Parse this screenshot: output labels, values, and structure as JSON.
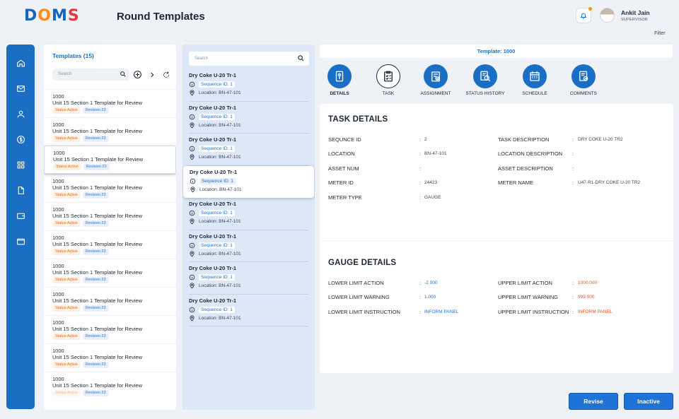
{
  "app": {
    "logo": [
      "D",
      "O",
      "M",
      "S"
    ],
    "page_title": "Round Templates",
    "user": {
      "name": "Ankit Jain",
      "role": "SUPERVISOR"
    },
    "filter_label": "Filter"
  },
  "templates": {
    "title": "Templates (15)",
    "search_placeholder": "Search",
    "items": [
      {
        "code": "1000",
        "name": "Unit 15 Section 1 Template for Review",
        "status": "Status Active",
        "revision": "Revision 23"
      },
      {
        "code": "1000",
        "name": "Unit 15 Section 1 Template for Review",
        "status": "Status Active",
        "revision": "Revision 23"
      },
      {
        "code": "1000",
        "name": "Unit 15 Section 1 Template for Review",
        "status": "Status Active",
        "revision": "Revision 23"
      },
      {
        "code": "1000",
        "name": "Unit 15 Section 1 Template for Review",
        "status": "Status Active",
        "revision": "Revision 23"
      },
      {
        "code": "1000",
        "name": "Unit 15 Section 1 Template for Review",
        "status": "Status Active",
        "revision": "Revision 23"
      },
      {
        "code": "1000",
        "name": "Unit 15 Section 1 Template for Review",
        "status": "Status Active",
        "revision": "Revision 23"
      },
      {
        "code": "1000",
        "name": "Unit 15 Section 1 Template for Review",
        "status": "Status Active",
        "revision": "Revision 23"
      },
      {
        "code": "1000",
        "name": "Unit 15 Section 1 Template for Review",
        "status": "Status Active",
        "revision": "Revision 23"
      },
      {
        "code": "1000",
        "name": "Unit 15 Section 1 Template for Review",
        "status": "Status Active",
        "revision": "Revision 23"
      },
      {
        "code": "1000",
        "name": "Unit 15 Section 1 Template for Review",
        "status": "Status Active",
        "revision": "Revision 23"
      },
      {
        "code": "1000",
        "name": "Unit 15 Section 1 Template for Review",
        "status": "Status Active",
        "revision": "Revision 23"
      }
    ]
  },
  "sequences": {
    "search_placeholder": "Search",
    "items": [
      {
        "name": "Dry Coke U-20 Tr-1",
        "sequence": "Sequence ID: 1",
        "location": "Location: BN-47-101"
      },
      {
        "name": "Dry Coke U-20 Tr-1",
        "sequence": "Sequence ID: 1",
        "location": "Location: BN-47-101"
      },
      {
        "name": "Dry Coke U-20 Tr-1",
        "sequence": "Sequence ID: 1",
        "location": "Location: BN-47-101"
      },
      {
        "name": "Dry Coke U-20 Tr-1",
        "sequence": "Sequence ID: 1",
        "location": "Location: BN-47-101"
      },
      {
        "name": "Dry Coke U-20 Tr-1",
        "sequence": "Sequence ID: 1",
        "location": "Location: BN-47-101"
      },
      {
        "name": "Dry Coke U-20 Tr-1",
        "sequence": "Sequence ID: 1",
        "location": "Location: BN-47-101"
      },
      {
        "name": "Dry Coke U-20 Tr-1",
        "sequence": "Sequence ID: 1",
        "location": "Location: BN-47-101"
      },
      {
        "name": "Dry Coke U-20 Tr-1",
        "sequence": "Sequence ID: 1",
        "location": "Location: BN-47-101"
      }
    ]
  },
  "detail": {
    "banner": "Template: 1000",
    "tabs": [
      {
        "label": "DETAILS",
        "icon": "details-icon"
      },
      {
        "label": "TASK",
        "icon": "task-icon"
      },
      {
        "label": "ASSIGNMENT",
        "icon": "assignment-icon"
      },
      {
        "label": "STATUS HISTORY",
        "icon": "status-history-icon"
      },
      {
        "label": "SCHEDULE",
        "icon": "schedule-icon"
      },
      {
        "label": "COMMENTS",
        "icon": "comments-icon"
      }
    ],
    "task_title": "TASK DETAILS",
    "task_fields_left": [
      {
        "label": "SEQUNCE ID",
        "value": "2"
      },
      {
        "label": "LOCATION",
        "value": "BN-47-101"
      },
      {
        "label": "ASSET NUM",
        "value": ""
      },
      {
        "label": "METER ID",
        "value": "24423"
      },
      {
        "label": "METER TYPE",
        "value": "GAUGE"
      }
    ],
    "task_fields_right": [
      {
        "label": "TASK DESCRIPTION",
        "value": "DRY COKE U-20 TR2"
      },
      {
        "label": "LOCATION DESCRIPTION",
        "value": ""
      },
      {
        "label": "ASSET DESCRIPTION",
        "value": ""
      },
      {
        "label": "METER NAME",
        "value": "U47-R1-DRY COKE U-20 TR2"
      }
    ],
    "gauge_title": "GAUGE DETAILS",
    "gauge_fields_left": [
      {
        "label": "LOWER LIMIT ACTION",
        "value": "-2.000"
      },
      {
        "label": "LOWER LIMIT WARNING",
        "value": "1.000"
      },
      {
        "label": "LOWER LIMIT INSTRUCTION",
        "value": "INFORM PANEL"
      }
    ],
    "gauge_fields_right": [
      {
        "label": "UPPER LIMIT ACTION",
        "value": "1000.000"
      },
      {
        "label": "UPPER LIMIT WARNING",
        "value": "999.000"
      },
      {
        "label": "UPPER LIMIT INSTRUCTION",
        "value": "INFORM PANEL"
      }
    ]
  },
  "actions": {
    "revise": "Revise",
    "inactive": "Inactive"
  },
  "colors": {
    "primary": "#1a6fc4",
    "accent_orange": "#ff8c1a",
    "danger": "#e53935",
    "value_red": "#e8501a"
  }
}
